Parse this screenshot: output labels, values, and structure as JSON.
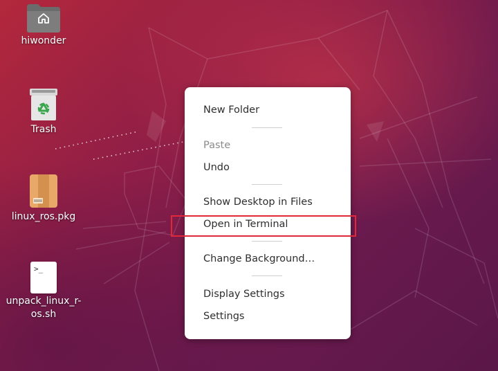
{
  "desktop": {
    "icons": [
      {
        "label": "hiwonder",
        "icon": "home-folder-icon"
      },
      {
        "label": "Trash",
        "icon": "trash-icon"
      },
      {
        "label": "linux_ros.pkg",
        "icon": "package-icon"
      },
      {
        "label": "unpack_linux_r-os.sh",
        "label_lines": [
          "unpack_linux_r-",
          "os.sh"
        ],
        "icon": "script-file-icon",
        "glyph_text": ">_"
      }
    ]
  },
  "context_menu": {
    "items": {
      "new_folder": "New Folder",
      "paste": "Paste",
      "undo": "Undo",
      "show_desktop": "Show Desktop in Files",
      "open_terminal": "Open in Terminal",
      "change_background": "Change Background…",
      "display_settings": "Display Settings",
      "settings": "Settings"
    },
    "highlighted_item": "Open in Terminal",
    "highlight_color": "#e0283a"
  },
  "colors": {
    "wallpaper_top": "#b3283c",
    "wallpaper_bottom": "#5a1748",
    "menu_bg": "#ffffff"
  }
}
